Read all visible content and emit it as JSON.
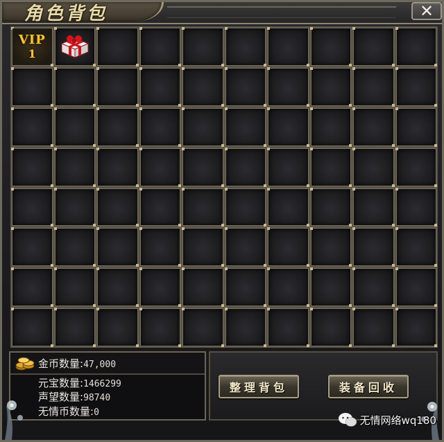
{
  "window": {
    "title": "角色背包",
    "close_glyph": "✕"
  },
  "inventory": {
    "columns": 10,
    "rows": 8,
    "slots": [
      {
        "type": "vip",
        "label": "VIP",
        "level": "1"
      },
      {
        "type": "item",
        "icon": "gift-box-icon"
      }
    ]
  },
  "currency": {
    "gold_label": "金币数量:",
    "gold_value": "47,000",
    "yuanbao_label": "元宝数量:",
    "yuanbao_value": "1466299",
    "prestige_label": "声望数量:",
    "prestige_value": "98740",
    "wuqing_label": "无情币数量:",
    "wuqing_value": "0"
  },
  "actions": {
    "sort_label": "整理背包",
    "recycle_label": "装备回收"
  },
  "watermark": {
    "text": "无情网络wq180"
  },
  "colors": {
    "accent_gold": "#f6c23a",
    "frame": "#6f6a5e",
    "slot_bg": "#1a1a1d"
  }
}
